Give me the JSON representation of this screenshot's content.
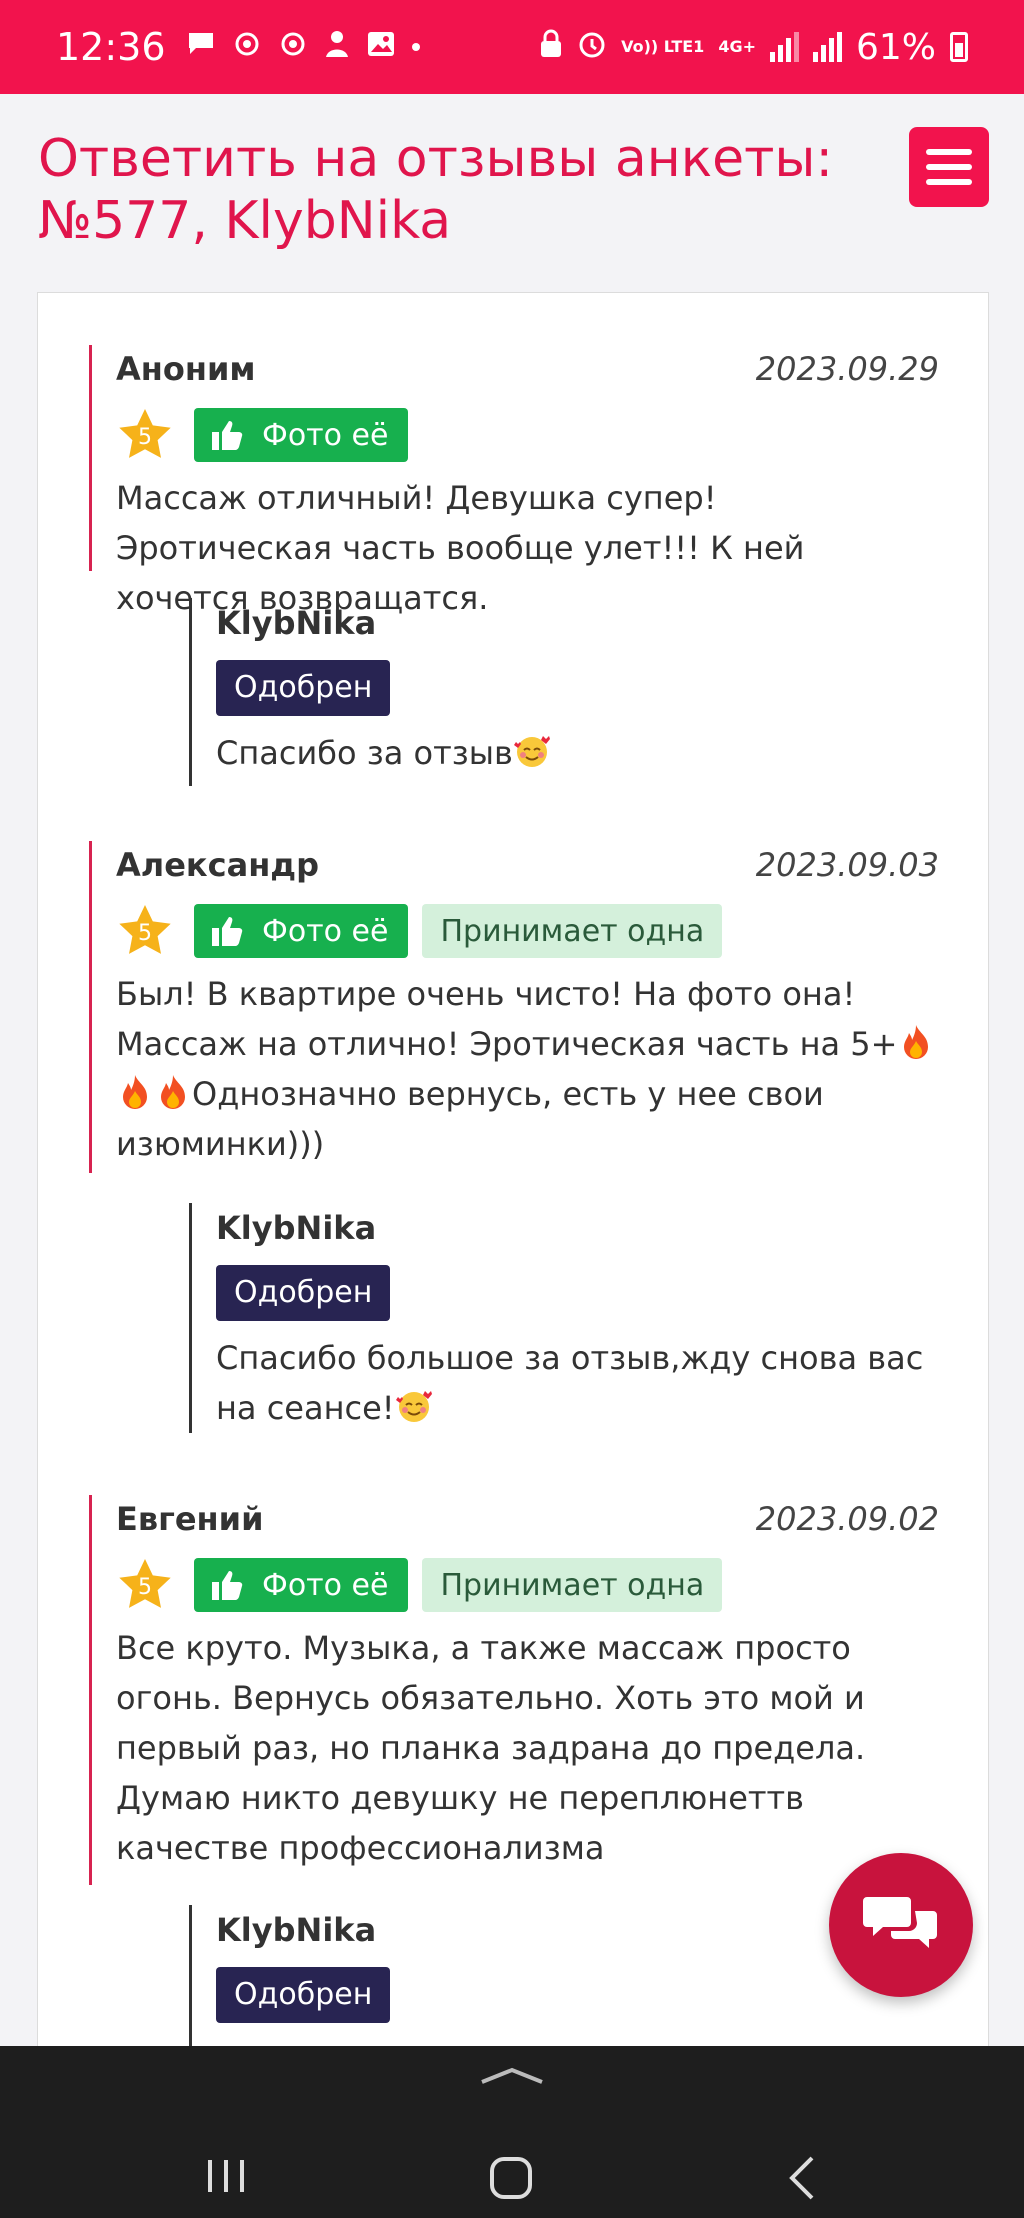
{
  "status_bar": {
    "time": "12:36",
    "network_label": "Vo)) LTE1",
    "network_type": "4G+",
    "battery": "61%"
  },
  "header": {
    "title": "Ответить на отзывы анкеты: №577, KlybNika",
    "menu_icon": "hamburger-icon"
  },
  "colors": {
    "brand": "#f2134d",
    "title": "#e0154c",
    "photo_badge": "#17b04e",
    "alone_badge": "#d4f0db",
    "approved_badge": "#282452"
  },
  "reviews": [
    {
      "author": "Аноним",
      "date": "2023.09.29",
      "rating": "5",
      "photo_badge": "Фото её",
      "alone_badge": "",
      "text": "Массаж отличный! Девушка супер! Эротическая часть вообще улет!!! К ней хочется возвращатся.",
      "reply": {
        "author": "KlybNika",
        "status": "Одобрен",
        "text": "Спасибо за отзыв"
      }
    },
    {
      "author": "Александр",
      "date": "2023.09.03",
      "rating": "5",
      "photo_badge": "Фото её",
      "alone_badge": "Принимает одна",
      "text_line1": "Был! В квартире очень чисто! На фото она! Массаж на отлично! Эротическая часть на 5+",
      "text_line2": "Однозначно вернусь, есть у нее свои изюминки)))",
      "reply": {
        "author": "KlybNika",
        "status": "Одобрен",
        "text": "Спасибо большое за отзыв,жду снова вас на сеансе!"
      }
    },
    {
      "author": "Евгений",
      "date": "2023.09.02",
      "rating": "5",
      "photo_badge": "Фото её",
      "alone_badge": "Принимает одна",
      "text": "Все круто. Музыка, а также массаж просто огонь. Вернусь обязательно. Хоть это мой и первый раз, но планка задрана до предела. Думаю никто девушку не переплюнеттв качестве профессионализма",
      "reply": {
        "author": "KlybNika",
        "status": "Одобрен"
      }
    }
  ]
}
